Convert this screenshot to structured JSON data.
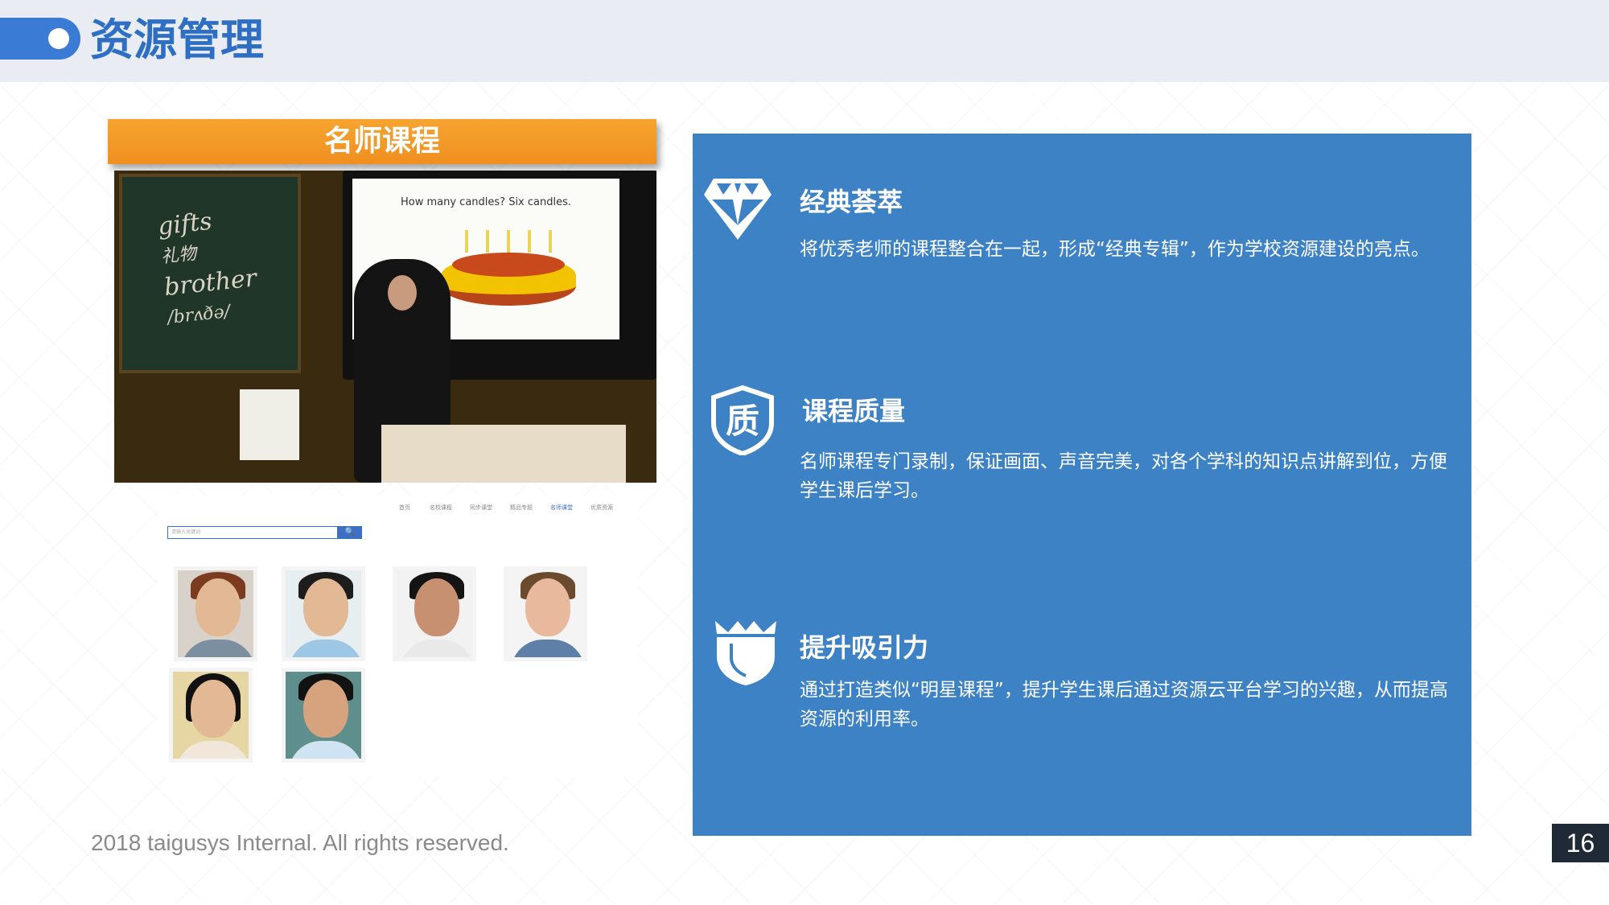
{
  "header": {
    "title": "资源管理"
  },
  "banner": {
    "label": "名师课程"
  },
  "classroom": {
    "chalkboard_text": [
      "gifts",
      "礼物",
      "brother",
      "/brʌðə/"
    ],
    "screen_question": "How many candles? Six candles."
  },
  "portal": {
    "nav": [
      "首页",
      "名校课程",
      "同步课堂",
      "精品专题",
      "名师课堂",
      "优质资源"
    ],
    "search_placeholder": "请输入关键词",
    "search_button": "🔍"
  },
  "features": [
    {
      "icon": "diamond-icon",
      "title": "经典荟萃",
      "desc": "将优秀老师的课程整合在一起，形成“经典专辑”，作为学校资源建设的亮点。"
    },
    {
      "icon": "quality-badge-icon",
      "title": "课程质量",
      "desc": "名师课程专门录制，保证画面、声音完美，对各个学科的知识点讲解到位，方便学生课后学习。"
    },
    {
      "icon": "shield-crown-icon",
      "title": "提升吸引力",
      "desc": "通过打造类似“明星课程”，提升学生课后通过资源云平台学习的兴趣，从而提高资源的利用率。"
    }
  ],
  "footer": {
    "copyright": "2018 taigusys Internal. All rights reserved.",
    "page": "16"
  },
  "colors": {
    "accent": "#3e82c6",
    "header_blue": "#2e6fc4",
    "banner_orange": "#f39a26"
  }
}
